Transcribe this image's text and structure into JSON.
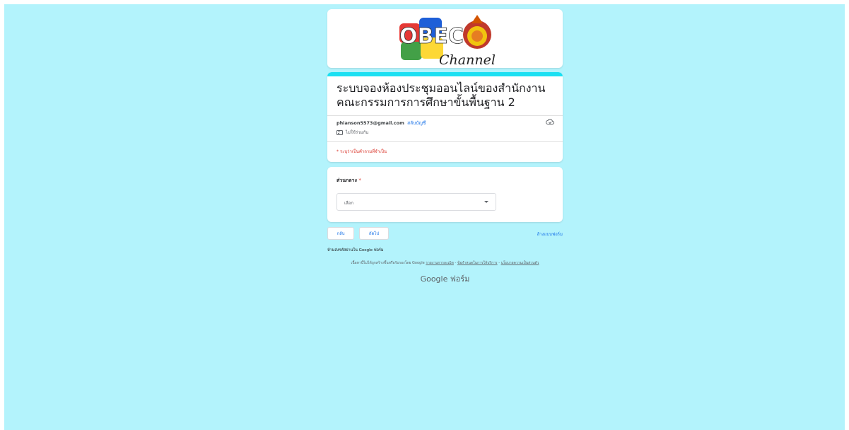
{
  "header": {
    "logo_text_main": "OBEC",
    "logo_text_sub": "Channel"
  },
  "form": {
    "title": "ระบบจองห้องประชุมออนไลน์ของสำนักงานคณะกรรมการการศึกษาขั้นพื้นฐาน 2",
    "email": "phianson5573@gmail.com",
    "switch_account": "สลับบัญชี",
    "not_shared": "ไม่ใช้ร่วมกัน",
    "required_note": "* ระบุว่าเป็นคำถามที่จำเป็น"
  },
  "question": {
    "label": "ส่วนกลาง",
    "required_star": "*",
    "select_value": "เลือก"
  },
  "nav": {
    "back_label": "กลับ",
    "next_label": "ถัดไป",
    "clear_label": "ล้างแบบฟอร์ม"
  },
  "footer": {
    "never_submit": "ห้ามส่งรหัสผ่านใน Google ฟอร์ม",
    "notice_prefix": "เนื้อหานี้ไม่ได้ถูกสร้างขึ้นหรือรับรองโดย Google",
    "report_abuse": "รายงานการละเมิด",
    "terms": "ข้อกำหนดในการให้บริการ",
    "privacy": "นโยบายความเป็นส่วนตัว",
    "separator": " - ",
    "brand_google": "Google",
    "brand_forms": "ฟอร์ม"
  },
  "colors": {
    "background": "#b3f3fc",
    "accent": "#1be0f2",
    "link": "#1a73e8",
    "required": "#d93025"
  }
}
